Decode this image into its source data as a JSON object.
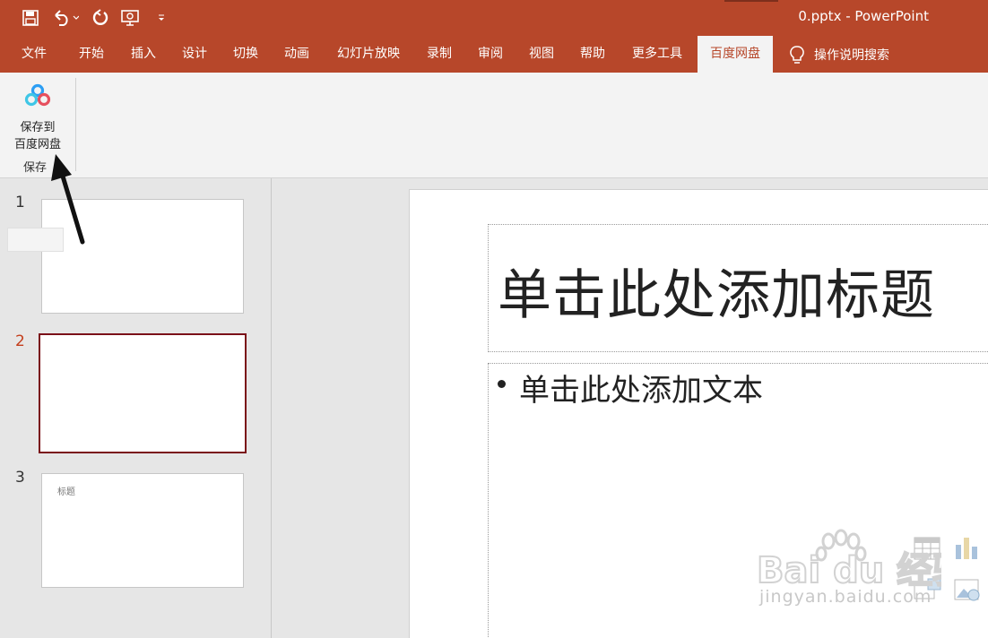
{
  "window": {
    "title": "0.pptx  -  PowerPoint"
  },
  "qat": {
    "icons": [
      "save-icon",
      "undo-icon",
      "redo-icon",
      "slideshow-icon",
      "customize-icon"
    ]
  },
  "tabs": [
    {
      "label": "文件"
    },
    {
      "label": "开始"
    },
    {
      "label": "插入"
    },
    {
      "label": "设计"
    },
    {
      "label": "切换"
    },
    {
      "label": "动画"
    },
    {
      "label": "幻灯片放映"
    },
    {
      "label": "录制"
    },
    {
      "label": "审阅"
    },
    {
      "label": "视图"
    },
    {
      "label": "帮助"
    },
    {
      "label": "更多工具"
    },
    {
      "label": "百度网盘"
    }
  ],
  "tell_me": {
    "label": "操作说明搜索"
  },
  "ribbon": {
    "save_button_line1": "保存到",
    "save_button_line2": "百度网盘",
    "group_label": "保存"
  },
  "slides": [
    {
      "number": "1",
      "title": ""
    },
    {
      "number": "2",
      "title": ""
    },
    {
      "number": "3",
      "title": "标题"
    }
  ],
  "active_slide": 2,
  "slide": {
    "title_placeholder": "单击此处添加标题",
    "body_placeholder": "单击此处添加文本"
  },
  "watermark": {
    "logo": "Bai du 经验",
    "url": "jingyan.baidu.com"
  },
  "colors": {
    "accent": "#b7472a",
    "active_slide_border": "#7a1018"
  }
}
